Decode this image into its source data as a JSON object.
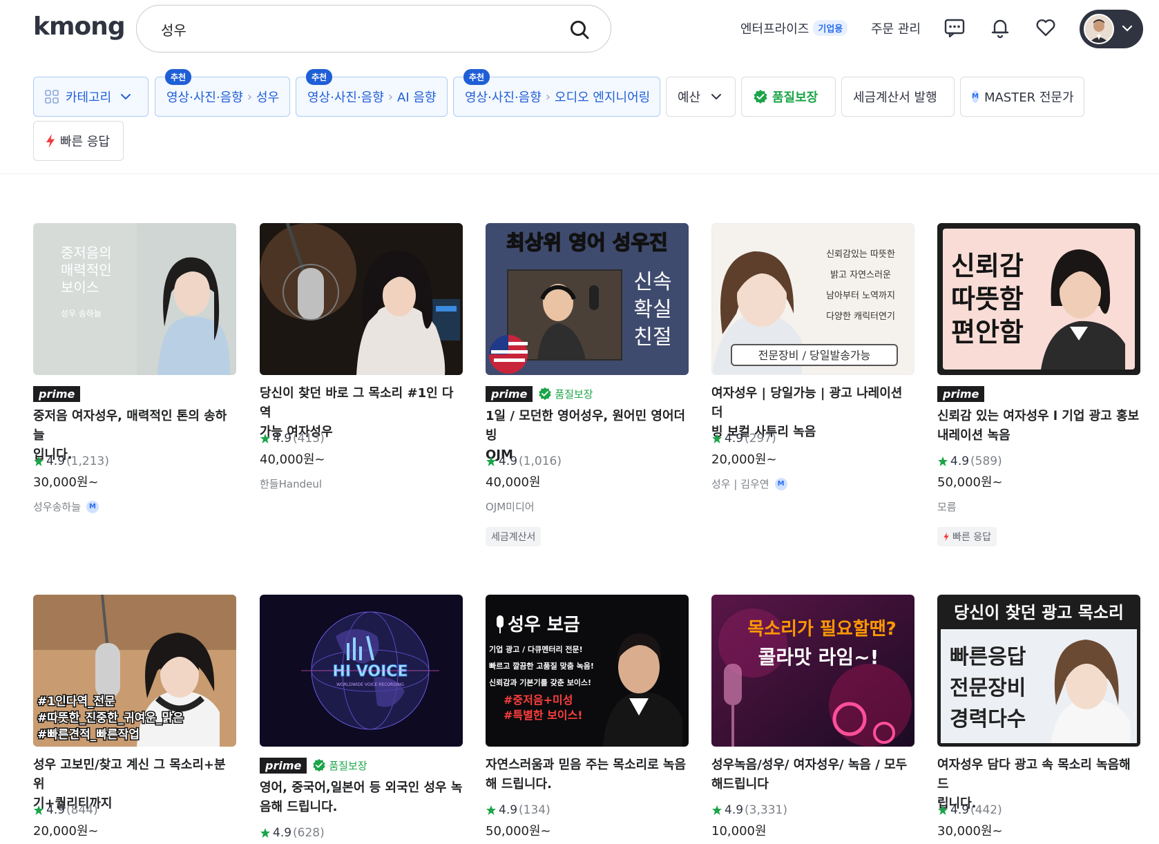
{
  "header": {
    "logo": "kmong",
    "search_value": "성우",
    "enterprise_label": "엔터프라이즈",
    "enterprise_badge": "기업용",
    "orders_label": "주문 관리"
  },
  "filters": {
    "category": "카테고리",
    "rec_tag": "추천",
    "rec1": {
      "cat": "영상·사진·음향",
      "sub": "성우"
    },
    "rec2": {
      "cat": "영상·사진·음향",
      "sub": "AI 음향"
    },
    "rec3": {
      "cat": "영상·사진·음향",
      "sub": "오디오 엔지니어링"
    },
    "budget": "예산",
    "quality": "품질보장",
    "tax": "세금계산서 발행",
    "master_badge": "M",
    "master": "MASTER 전문가",
    "fast": "빠른 응답"
  },
  "labels": {
    "prime": "prime",
    "quality": "품질보장"
  },
  "thumbs": {
    "t1": {
      "l1": "중저음의",
      "l2": "매력적인",
      "l3": "보이스",
      "l4": "성우 송하늘"
    },
    "t3": {
      "top": "최상위 영어 성우진",
      "s1": "신속",
      "s2": "확실",
      "s3": "친절"
    },
    "t4": {
      "l1": "신뢰감있는 따뜻한",
      "l2": "밝고 자연스러운",
      "l3": "남아부터 노역까지",
      "l4": "다양한 캐릭터연기",
      "box": "전문장비 / 당일발송가능"
    },
    "t5": {
      "l1": "신뢰감",
      "l2": "따뜻함",
      "l3": "편안함"
    },
    "t6": {
      "l1": "#1인다역_전문",
      "l2": "#따뜻한_진중한_귀여운_맑은",
      "l3": "#빠른견적_빠른작업"
    },
    "t7": {
      "logo": "HI VOICE",
      "sub": "WORLDWIDE VOICE RECORDING"
    },
    "t8": {
      "title": "성우 보금",
      "l1": "기업 광고 / 다큐멘터리 전문!",
      "l2": "빠르고 깔끔한 고품질 맞춤 녹음!",
      "l3": "신뢰감과 기본기를 갖춘 보이스!",
      "l4": "#중저음+미성",
      "l5": "#특별한 보이스!"
    },
    "t9": {
      "l1": "목소리가 필요할땐?",
      "l2": "콜라맛 라임~!"
    },
    "t10": {
      "top": "당신이 찾던 광고 목소리",
      "l1": "빠른응답",
      "l2": "전문장비",
      "l3": "경력다수"
    }
  },
  "cards": [
    {
      "title1": "중저음 여자성우, 매력적인 톤의 송하늘",
      "title2": "입니다.",
      "rating": "4.9",
      "count": "(1,213)",
      "price": "30,000원~",
      "seller": "성우송하늘"
    },
    {
      "title1": "당신이 찾던 바로 그 목소리 #1인 다역",
      "title2": "가능 여자성우",
      "rating": "4.9",
      "count": "(413)",
      "price": "40,000원~",
      "seller": "한들Handeul"
    },
    {
      "title1": "1일 / 모던한 영어성우, 원어민 영어더빙",
      "title2": "OJM",
      "rating": "4.9",
      "count": "(1,016)",
      "price": "40,000원",
      "seller": "OJM미디어",
      "tag": "세금계산서"
    },
    {
      "title1": "여자성우 | 당일가능 | 광고 나레이션 더",
      "title2": "빙 보컬 사투리 녹음",
      "rating": "4.9",
      "count": "(297)",
      "price": "20,000원~",
      "seller": "성우 | 김우연"
    },
    {
      "title1": "신뢰감 있는 여자성우 l 기업 광고 홍보",
      "title2": "내레이션 녹음",
      "rating": "4.9",
      "count": "(589)",
      "price": "50,000원~",
      "seller": "모름",
      "tag": "빠른 응답"
    },
    {
      "title1": "성우 고보민/찾고 계신 그 목소리+분위",
      "title2": "기+퀄리티까지",
      "rating": "4.9",
      "count": "(844)",
      "price": "20,000원~"
    },
    {
      "title1": "영어, 중국어,일본어 등 외국인 성우 녹",
      "title2": "음해 드립니다.",
      "rating": "4.9",
      "count": "(628)"
    },
    {
      "title1": "자연스러움과 믿음 주는 목소리로 녹음",
      "title2": "해 드립니다.",
      "rating": "4.9",
      "count": "(134)",
      "price": "50,000원~"
    },
    {
      "title1": "성우녹음/성우/ 여자성우/ 녹음 / 모두",
      "title2": "해드립니다",
      "rating": "4.9",
      "count": "(3,331)",
      "price": "10,000원"
    },
    {
      "title1": "여자성우 담다 광고 속 목소리 녹음해 드",
      "title2": "립니다.",
      "rating": "4.9",
      "count": "(442)",
      "price": "30,000원~"
    }
  ]
}
